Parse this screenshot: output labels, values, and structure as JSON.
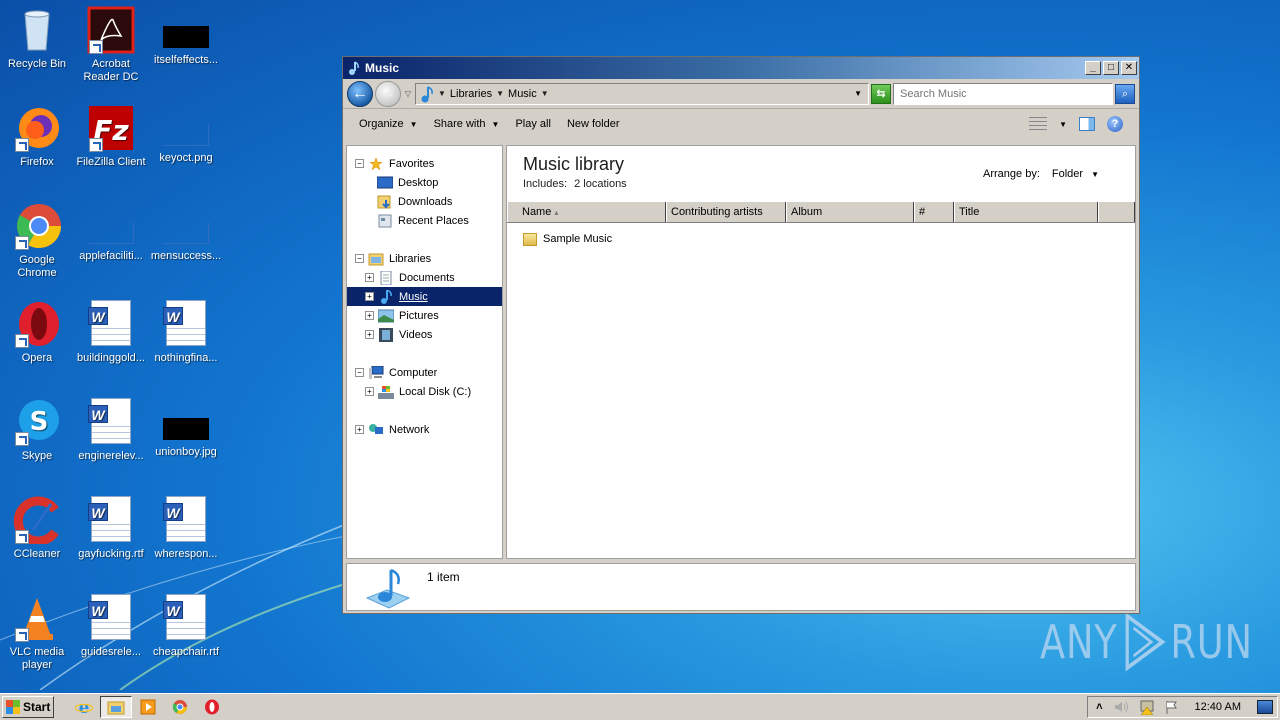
{
  "desktop": {
    "icons": [
      {
        "label": "Recycle Bin",
        "icon": "recycle-bin-icon"
      },
      {
        "label": "Acrobat Reader DC",
        "icon": "acrobat-icon"
      },
      {
        "label": "itselfeffects...",
        "icon": "image-thumbnail-icon"
      },
      {
        "label": "Firefox",
        "icon": "firefox-icon"
      },
      {
        "label": "FileZilla Client",
        "icon": "filezilla-icon"
      },
      {
        "label": "keyoct.png",
        "icon": "image-thumbnail-icon"
      },
      {
        "label": "Google Chrome",
        "icon": "chrome-icon"
      },
      {
        "label": "applefaciliti...",
        "icon": "image-thumbnail-icon"
      },
      {
        "label": "mensuccess...",
        "icon": "image-thumbnail-icon"
      },
      {
        "label": "Opera",
        "icon": "opera-icon"
      },
      {
        "label": "buildinggold...",
        "icon": "word-doc-icon"
      },
      {
        "label": "nothingfina...",
        "icon": "word-doc-icon"
      },
      {
        "label": "Skype",
        "icon": "skype-icon"
      },
      {
        "label": "enginerelev...",
        "icon": "word-doc-icon"
      },
      {
        "label": "unionboy.jpg",
        "icon": "image-thumbnail-icon"
      },
      {
        "label": "CCleaner",
        "icon": "ccleaner-icon"
      },
      {
        "label": "gayfucking.rtf",
        "icon": "word-doc-icon"
      },
      {
        "label": "wherespon...",
        "icon": "word-doc-icon"
      },
      {
        "label": "VLC media player",
        "icon": "vlc-icon"
      },
      {
        "label": "guidesrele...",
        "icon": "word-doc-icon"
      },
      {
        "label": "cheapchair.rtf",
        "icon": "word-doc-icon"
      }
    ],
    "watermark": {
      "left": "ANY",
      "right": "RUN"
    }
  },
  "window": {
    "title": "Music",
    "controls": {
      "minimize": "_",
      "maximize": "□",
      "close": "✕"
    },
    "address": {
      "crumbs": [
        "Libraries",
        "Music"
      ],
      "search_placeholder": "Search Music"
    },
    "toolbar": {
      "organize": "Organize",
      "share_with": "Share with",
      "play_all": "Play all",
      "new_folder": "New folder"
    },
    "nav": {
      "favorites": {
        "label": "Favorites",
        "items": [
          "Desktop",
          "Downloads",
          "Recent Places"
        ]
      },
      "libraries": {
        "label": "Libraries",
        "items": [
          "Documents",
          "Music",
          "Pictures",
          "Videos"
        ],
        "selected": "Music"
      },
      "computer": {
        "label": "Computer",
        "items": [
          "Local Disk (C:)"
        ]
      },
      "network": {
        "label": "Network"
      }
    },
    "content": {
      "title": "Music library",
      "includes_label": "Includes:",
      "includes_value": "2 locations",
      "arrange_label": "Arrange by:",
      "arrange_value": "Folder",
      "columns": [
        "Name",
        "Contributing artists",
        "Album",
        "#",
        "Title"
      ],
      "sort_indicator": "▴",
      "rows": [
        {
          "name": "Sample Music",
          "type": "folder"
        }
      ]
    },
    "details": {
      "count": "1 item"
    }
  },
  "taskbar": {
    "start_label": "Start",
    "quick_launch": [
      "internet-explorer-icon",
      "windows-explorer-icon",
      "media-player-icon",
      "chrome-icon",
      "opera-icon"
    ],
    "tray": {
      "chevron": "˄",
      "clock": "12:40 AM"
    }
  }
}
